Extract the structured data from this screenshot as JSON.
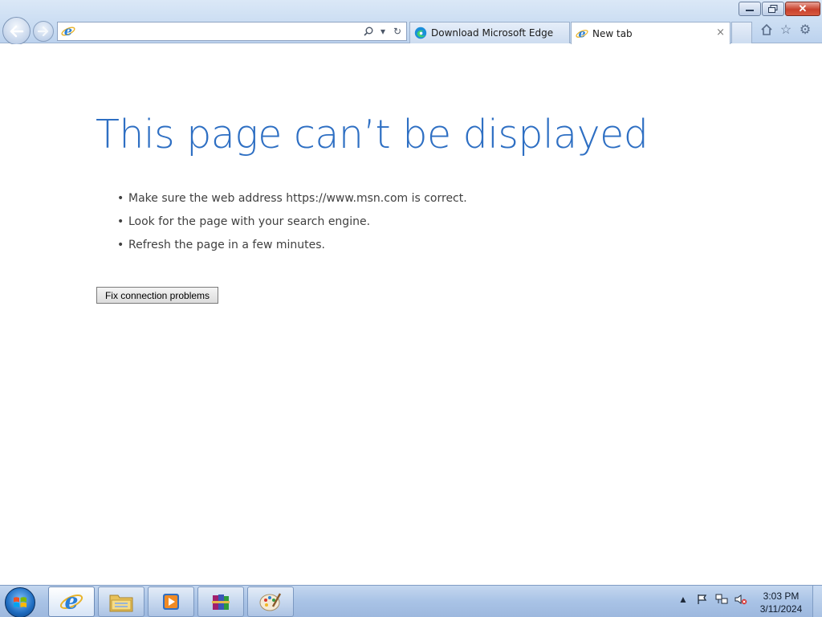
{
  "window": {
    "controls": {
      "minimize": "▭",
      "maximize": "❐",
      "close": "✕"
    }
  },
  "nav": {
    "back_icon": "back-arrow-icon",
    "forward_icon": "forward-arrow-icon",
    "address": {
      "value": "",
      "placeholder": ""
    },
    "address_tools": {
      "search": "⚲",
      "dropdown": "▾",
      "refresh": "↻"
    }
  },
  "tabs": [
    {
      "label": "Download Microsoft Edge",
      "icon": "edge-icon"
    },
    {
      "label": "New tab",
      "icon": "ie-icon",
      "close": "×",
      "active": true
    }
  ],
  "toolbar_icons": {
    "home": "⌂",
    "favorites": "☆",
    "settings": "⚙"
  },
  "page": {
    "title": "This page can’t be displayed",
    "bullets": [
      "Make sure the web address https://www.msn.com is correct.",
      "Look for the page with your search engine.",
      "Refresh the page in a few minutes."
    ],
    "fix_button": "Fix connection problems",
    "title_color": "#2e6fc3"
  },
  "taskbar": {
    "items": [
      "internet-explorer",
      "windows-explorer",
      "media-player",
      "winrar",
      "paint"
    ],
    "tray": {
      "show_hidden": "▲",
      "action_center": "⚑",
      "network": "🖧",
      "volume": "🔇"
    },
    "clock": {
      "time": "3:03 PM",
      "date": "3/11/2024"
    }
  }
}
